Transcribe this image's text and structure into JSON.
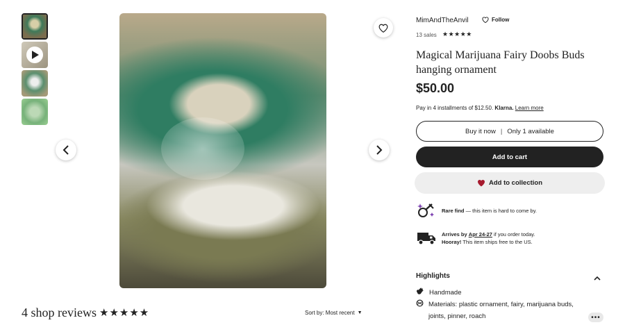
{
  "thumbnails": [
    {
      "kind": "image",
      "active": true
    },
    {
      "kind": "video",
      "icon": "play-icon"
    },
    {
      "kind": "image"
    },
    {
      "kind": "image"
    }
  ],
  "gallery": {
    "prev_icon": "chevron-left-icon",
    "next_icon": "chevron-right-icon",
    "favorite_icon": "heart-outline-icon"
  },
  "reviews": {
    "title": "4 shop reviews",
    "stars": "★★★★★",
    "sort_label": "Sort by: Most recent",
    "sort_caret": "▼"
  },
  "shop": {
    "name": "MimAndTheAnvil",
    "follow_label": "Follow",
    "sales": "13 sales",
    "stars": "★★★★★"
  },
  "listing": {
    "title": "Magical Marijuana Fairy Doobs Buds hanging ornament",
    "price": "$50.00",
    "installments_prefix": "Pay in 4 installments of $12.50.",
    "klarna": "Klarna.",
    "learn_more": "Learn more"
  },
  "actions": {
    "buy_now": "Buy it now",
    "buy_sep": "|",
    "availability": "Only 1 available",
    "add_to_cart": "Add to cart",
    "add_to_collection": "Add to collection"
  },
  "info": {
    "rare_bold": "Rare find",
    "rare_rest": " — this item is hard to come by.",
    "arrives_bold": "Arrives by",
    "arrives_date": "Apr 24-27",
    "arrives_rest": " if you order today.",
    "hooray_bold": "Hooray!",
    "hooray_rest": " This item ships free to the US."
  },
  "highlights": {
    "title": "Highlights",
    "items": [
      {
        "icon": "hand-icon",
        "text": "Handmade"
      },
      {
        "icon": "materials-icon",
        "text": "Materials: plastic ornament, fairy, marijuana buds, joints, pinner, roach"
      }
    ]
  },
  "more_label": "•••",
  "colors": {
    "primary": "#222222",
    "heart_fill": "#a61a2e",
    "collection_bg": "#eeeeee"
  }
}
